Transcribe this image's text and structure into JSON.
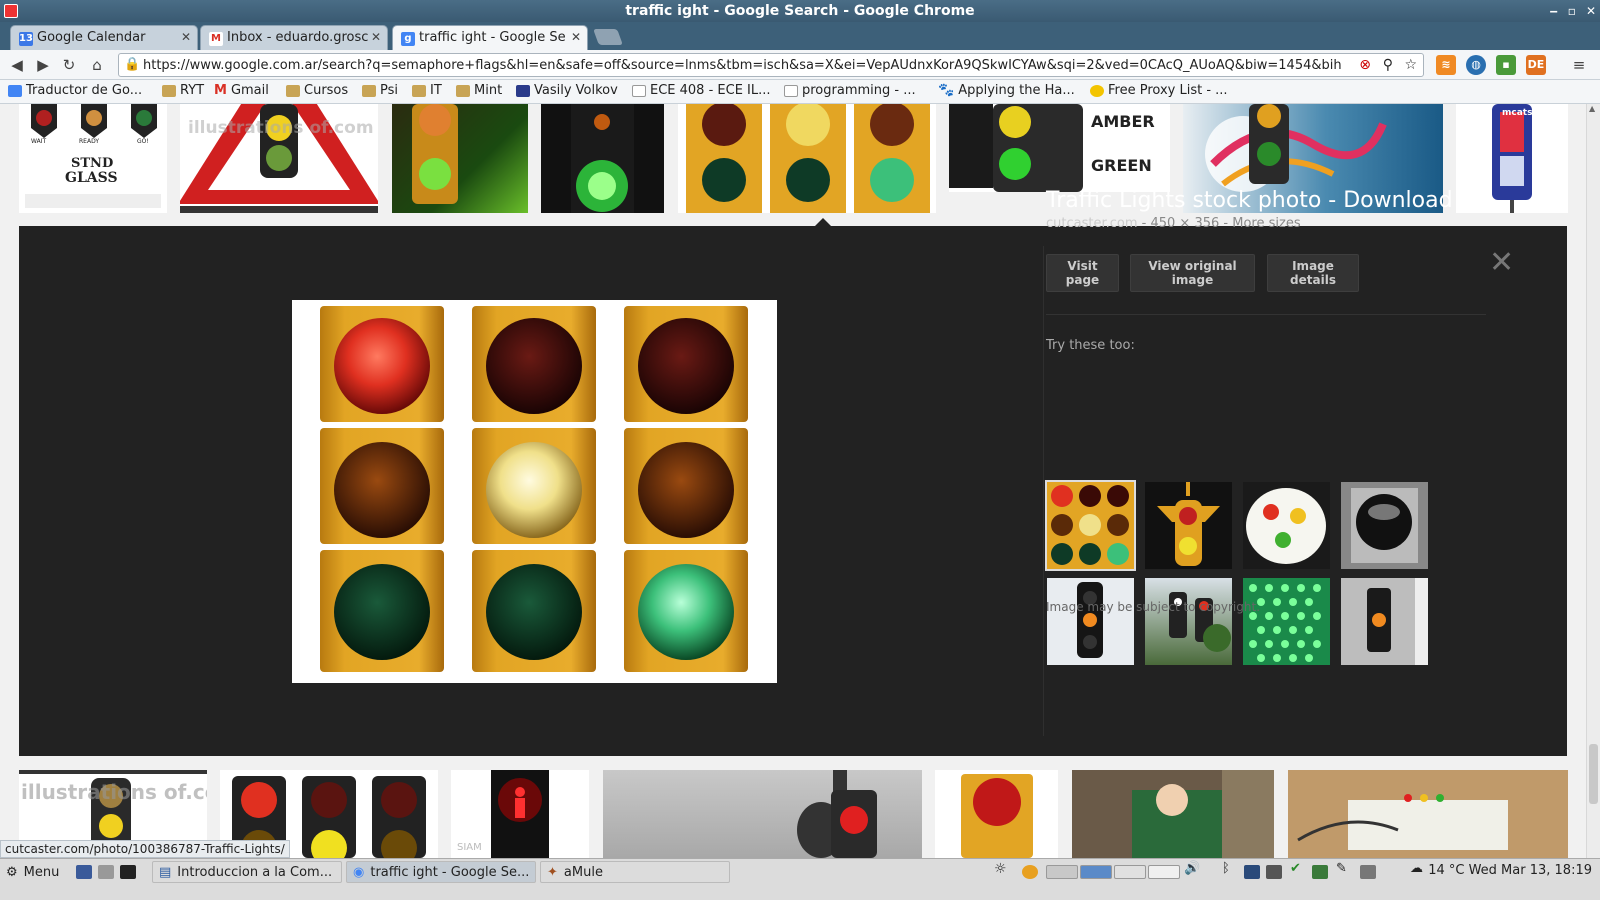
{
  "window": {
    "title": "traffic ight - Google Search - Google Chrome"
  },
  "tabs": [
    {
      "label": "Google Calendar",
      "icon": "calendar-icon",
      "color": "#3b78e7"
    },
    {
      "label": "Inbox - eduardo.grosc",
      "icon": "gmail-icon",
      "color": "#d93025"
    },
    {
      "label": "traffic ight - Google Se",
      "icon": "google-icon",
      "color": "#4285f4"
    }
  ],
  "omnibox": {
    "url": "https://www.google.com.ar/search?q=semaphore+flags&hl=en&safe=off&source=lnms&tbm=isch&sa=X&ei=VepAUdnxKorA9QSkwICYAw&sqi=2&ved=0CAcQ_AUoAQ&biw=1454&bih=697"
  },
  "bookmarks": [
    {
      "label": "Traductor de Go...",
      "icon": "translate-icon"
    },
    {
      "label": "RYT",
      "icon": "folder-icon"
    },
    {
      "label": "Gmail",
      "icon": "gmail-icon"
    },
    {
      "label": "Cursos",
      "icon": "folder-icon"
    },
    {
      "label": "Psi",
      "icon": "folder-icon"
    },
    {
      "label": "IT",
      "icon": "folder-icon"
    },
    {
      "label": "Mint",
      "icon": "folder-icon"
    },
    {
      "label": "Vasily Volkov",
      "icon": "page-icon"
    },
    {
      "label": "ECE 408 - ECE IL...",
      "icon": "page-icon"
    },
    {
      "label": "programming - ...",
      "icon": "page-icon"
    },
    {
      "label": "Applying the Ha...",
      "icon": "paw-icon"
    },
    {
      "label": "Free Proxy List - ...",
      "icon": "proxy-icon"
    }
  ],
  "results_top": {
    "thumb0_text": [
      "WAIT",
      "READY",
      "GO!",
      "STND",
      "GLASS"
    ],
    "thumb1_text": "illustrations of.com",
    "thumb5_text": [
      "AMBER",
      "GREEN"
    ],
    "thumb7_text": "mcatso"
  },
  "preview": {
    "title": "Traffic Lights stock photo - Download a...",
    "site": "cutcaster.com",
    "dims": "450 × 356",
    "more_sizes": "More sizes",
    "buttons": {
      "visit": "Visit page",
      "view_original": "View original image",
      "details": "Image details"
    },
    "try_label": "Try these too:",
    "copyright": "Image may be subject to copyright."
  },
  "results_bottom": {
    "thumb0_text": "illustrations of.com",
    "thumb2_text": "SIAM"
  },
  "status_url": "cutcaster.com/photo/100386787-Traffic-Lights/",
  "taskbar": {
    "menu": "Menu",
    "windows": [
      {
        "label": "Introduccion a la Com...",
        "icon": "document-icon"
      },
      {
        "label": "traffic ight - Google Se...",
        "icon": "chrome-icon"
      },
      {
        "label": "aMule",
        "icon": "amule-icon"
      }
    ],
    "clock": "14 °C Wed Mar 13, 18:19"
  },
  "colors": {
    "accent": "#3d6079",
    "panel": "#222222",
    "traffic_yellow": "#e2a524",
    "red_light": "#e03020",
    "green_light": "#3cc07a",
    "amber_light": "#f0e08a"
  }
}
